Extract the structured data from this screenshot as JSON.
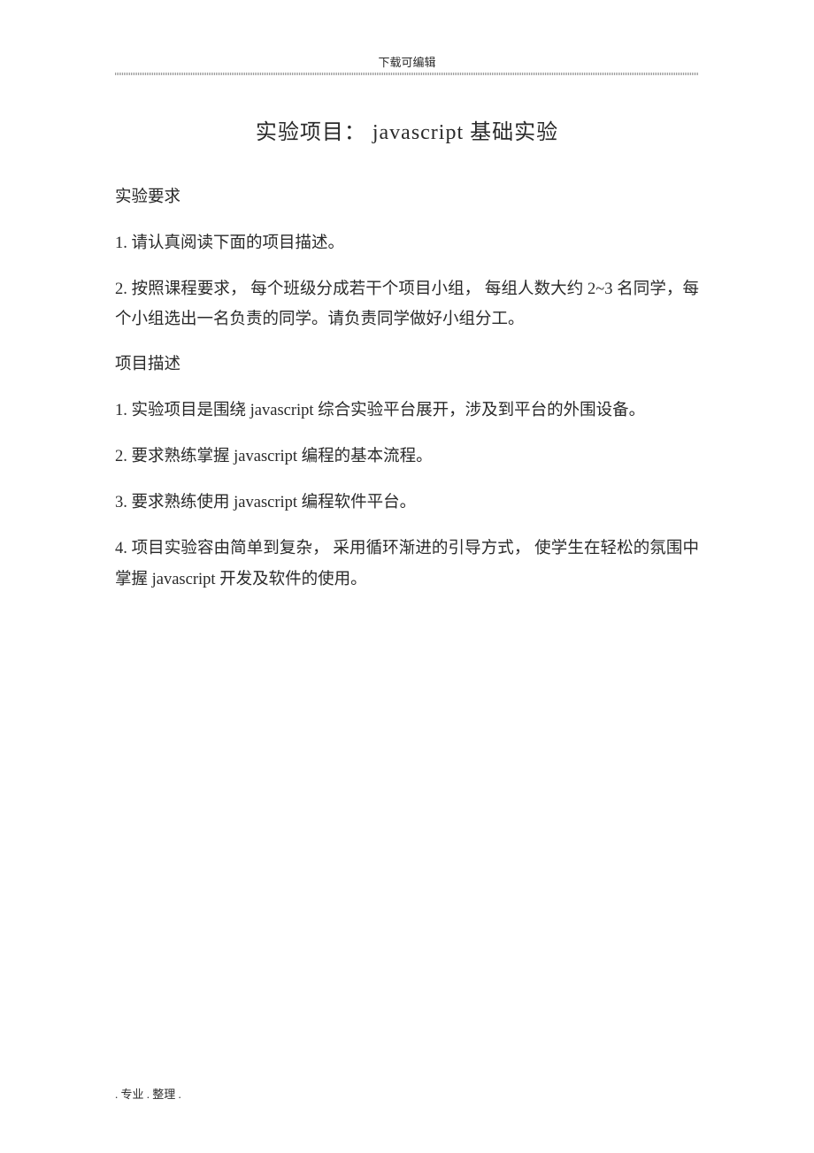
{
  "header": {
    "label": "下载可编辑"
  },
  "title": "实验项目： javascript 基础实验",
  "sections": [
    {
      "heading": "实验要求",
      "paragraphs": [
        "1. 请认真阅读下面的项目描述。",
        "2. 按照课程要求，  每个班级分成若干个项目小组，  每组人数大约 2~3 名同学，每个小组选出一名负责的同学。请负责同学做好小组分工。"
      ]
    },
    {
      "heading": "项目描述",
      "paragraphs": [
        "1. 实验项目是围绕  javascript   综合实验平台展开，涉及到平台的外围设备。",
        "2. 要求熟练掌握  javascript   编程的基本流程。",
        "3. 要求熟练使用  javascript   编程软件平台。",
        "4. 项目实验容由简单到复杂，  采用循环渐进的引导方式，  使学生在轻松的氛围中掌握 javascript 开发及软件的使用。"
      ]
    }
  ],
  "footer": ". 专业 . 整理 ."
}
